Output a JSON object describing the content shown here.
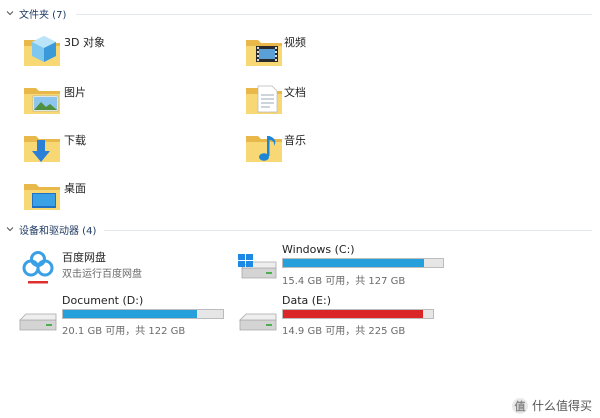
{
  "folders_group": {
    "header": "文件夹 (7)",
    "items": [
      {
        "label": "3D 对象",
        "icon": "3d-objects-icon"
      },
      {
        "label": "视频",
        "icon": "video-folder-icon"
      },
      {
        "label": "图片",
        "icon": "pictures-folder-icon"
      },
      {
        "label": "文档",
        "icon": "documents-folder-icon"
      },
      {
        "label": "下载",
        "icon": "downloads-folder-icon"
      },
      {
        "label": "音乐",
        "icon": "music-folder-icon"
      },
      {
        "label": "桌面",
        "icon": "desktop-folder-icon"
      }
    ]
  },
  "drives_group": {
    "header": "设备和驱动器 (4)",
    "items": [
      {
        "name": "百度网盘",
        "sub": "双击运行百度网盘",
        "icon": "baidu-netdisk-icon"
      },
      {
        "name": "Windows (C:)",
        "sub": "15.4 GB 可用，共 127 GB",
        "used_fraction": 0.879,
        "bar_color": "#26a0da",
        "icon": "windows-drive-icon"
      },
      {
        "name": "Document (D:)",
        "sub": "20.1 GB 可用，共 122 GB",
        "used_fraction": 0.835,
        "bar_color": "#26a0da",
        "icon": "hard-drive-icon"
      },
      {
        "name": "Data (E:)",
        "sub": "14.9 GB 可用，共 225 GB",
        "used_fraction": 0.934,
        "bar_color": "#da2626",
        "icon": "hard-drive-icon"
      }
    ]
  },
  "watermark": {
    "badge": "值",
    "text": "什么值得买"
  }
}
